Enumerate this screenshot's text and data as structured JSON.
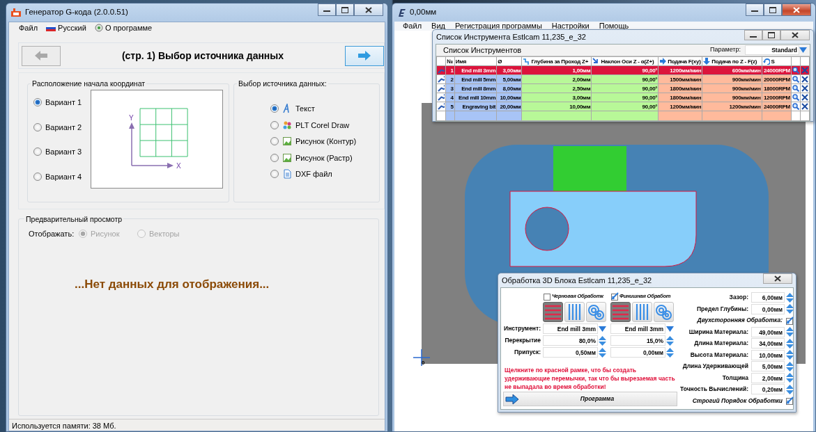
{
  "left_window": {
    "title": "Генератор G-кода (2.0.0.51)",
    "menu": [
      {
        "label": "Файл",
        "kind": "plain"
      },
      {
        "label": "Русский",
        "kind": "flag"
      },
      {
        "label": "О программе",
        "kind": "info"
      }
    ],
    "nav_buttons": [
      {
        "kind": "back",
        "disabled": true
      },
      {
        "kind": "forward",
        "disabled": false
      }
    ],
    "page_title": "(стр. 1) Выбор источника данных",
    "origin_group": {
      "title": "Расположение начала координат",
      "axis_x": "X",
      "axis_y": "Y",
      "options": [
        {
          "label": "Вариант 1",
          "selected": true
        },
        {
          "label": "Вариант 2",
          "selected": false
        },
        {
          "label": "Вариант 3",
          "selected": false
        },
        {
          "label": "Вариант 4",
          "selected": false
        }
      ]
    },
    "source_group": {
      "title": "Выбор источника данных:",
      "options": [
        {
          "label": "Текст",
          "kind": "text",
          "selected": true
        },
        {
          "label": "PLT Corel Draw",
          "kind": "plt",
          "selected": false
        },
        {
          "label": "Рисунок (Контур)",
          "kind": "image",
          "selected": false
        },
        {
          "label": "Рисунок (Растр)",
          "kind": "image",
          "selected": false
        },
        {
          "label": "DXF файл",
          "kind": "file",
          "selected": false
        }
      ]
    },
    "preview_group": {
      "title": "Предварительный просмотр",
      "display_label": "Отображать:",
      "options": [
        {
          "label": "Рисунок",
          "selected": true,
          "disabled": true
        },
        {
          "label": "Векторы",
          "selected": false,
          "disabled": true
        }
      ],
      "message": "...Нет данных для отображения..."
    },
    "status_bar": "Используется памяти: 38 Мб."
  },
  "right_window": {
    "title": "0,00мм",
    "menu": [
      "Файл",
      "Вид",
      "Регистрация программы",
      "Настройки",
      "Помощь"
    ],
    "origin_label": "0"
  },
  "tool_list": {
    "title": "Список Инструмента Estlcam 11,235_e_32",
    "heading": "Список Инструментов",
    "parameter_label": "Параметр:",
    "parameter_value": "Standard",
    "columns": [
      {
        "label": "№",
        "kind": "plain"
      },
      {
        "label": "Имя",
        "kind": "plain"
      },
      {
        "label": "Ø",
        "kind": "plain"
      },
      {
        "label": "Глубина за Проход Z+",
        "kind": "step"
      },
      {
        "label": "Наклон Оси Z - α(Z+)",
        "kind": "tilt"
      },
      {
        "label": "Подача F(xy)",
        "kind": "right"
      },
      {
        "label": "Подача по Z - F(z)",
        "kind": "down"
      },
      {
        "label": "S",
        "kind": "rotate"
      }
    ],
    "rows": [
      {
        "no": "1",
        "name": "End mill 3mm",
        "diameter": "3,00мм",
        "depth": "1,00мм",
        "angle": "90,00°",
        "feed_xy": "1200мм/мин",
        "feed_z": "600мм/мин",
        "speed": "24000RPM",
        "selected": true
      },
      {
        "no": "2",
        "name": "End mill 5mm",
        "diameter": "5,00мм",
        "depth": "2,00мм",
        "angle": "90,00°",
        "feed_xy": "1500мм/мин",
        "feed_z": "900мм/мин",
        "speed": "20000RPM",
        "selected": false
      },
      {
        "no": "3",
        "name": "End mill 8mm",
        "diameter": "8,00мм",
        "depth": "2,50мм",
        "angle": "90,00°",
        "feed_xy": "1800мм/мин",
        "feed_z": "900мм/мин",
        "speed": "18000RPM",
        "selected": false
      },
      {
        "no": "4",
        "name": "End mill 10mm",
        "diameter": "10,00мм",
        "depth": "3,00мм",
        "angle": "90,00°",
        "feed_xy": "1800мм/мин",
        "feed_z": "900мм/мин",
        "speed": "12000RPM",
        "selected": false
      },
      {
        "no": "5",
        "name": "Engraving bit",
        "diameter": "20,00мм",
        "depth": "10,00мм",
        "angle": "90,00°",
        "feed_xy": "1200мм/мин",
        "feed_z": "1200мм/мин",
        "speed": "24000RPM",
        "selected": false
      }
    ]
  },
  "machining_dialog": {
    "title": "Обработка 3D Блока Estlcam 11,235_e_32",
    "row_labels": {
      "tool": "Инструмент:",
      "overlap": "Перекрытие",
      "allowance": "Припуск:"
    },
    "passes": [
      {
        "label": "Черновая Обработк",
        "checked": false,
        "strategies": [
          {
            "kind": "horizontal",
            "selected": true
          },
          {
            "kind": "vertical",
            "selected": false
          },
          {
            "kind": "spiral",
            "selected": false
          }
        ],
        "tool": "End mill 3mm",
        "overlap": "80,0%",
        "allowance": "0,50мм"
      },
      {
        "label": "Финишная Обработ",
        "checked": true,
        "strategies": [
          {
            "kind": "horizontal",
            "selected": true
          },
          {
            "kind": "vertical",
            "selected": false
          },
          {
            "kind": "spiral",
            "selected": false
          }
        ],
        "tool": "End mill 3mm",
        "overlap": "15,0%",
        "allowance": "0,00мм"
      }
    ],
    "note": "Щелкните по красной рамке, что бы создать удерживающие перемычки, так что бы вырезаемая часть не выпадала во время обработки!",
    "program_button": "Программа",
    "settings": [
      {
        "kind": "field",
        "label": "Зазор:",
        "value": "6,00мм"
      },
      {
        "kind": "field",
        "label": "Предел Глубины:",
        "value": "0,00мм"
      },
      {
        "kind": "check",
        "label": "Двухсторонняя Обработка:",
        "checked": true
      },
      {
        "kind": "field",
        "label": "Ширина Материала:",
        "value": "49,00мм"
      },
      {
        "kind": "field",
        "label": "Длина Материала:",
        "value": "34,00мм"
      },
      {
        "kind": "field",
        "label": "Высота Материала:",
        "value": "10,00мм"
      },
      {
        "kind": "field",
        "label": "Длина Удерживающей",
        "value": "5,00мм"
      },
      {
        "kind": "field",
        "label": "Толщина",
        "value": "2,00мм"
      },
      {
        "kind": "field",
        "label": "Точность Вычислений:",
        "value": "0,20мм"
      },
      {
        "kind": "check",
        "label": "Строгий Порядок Обработки",
        "checked": true
      }
    ]
  }
}
